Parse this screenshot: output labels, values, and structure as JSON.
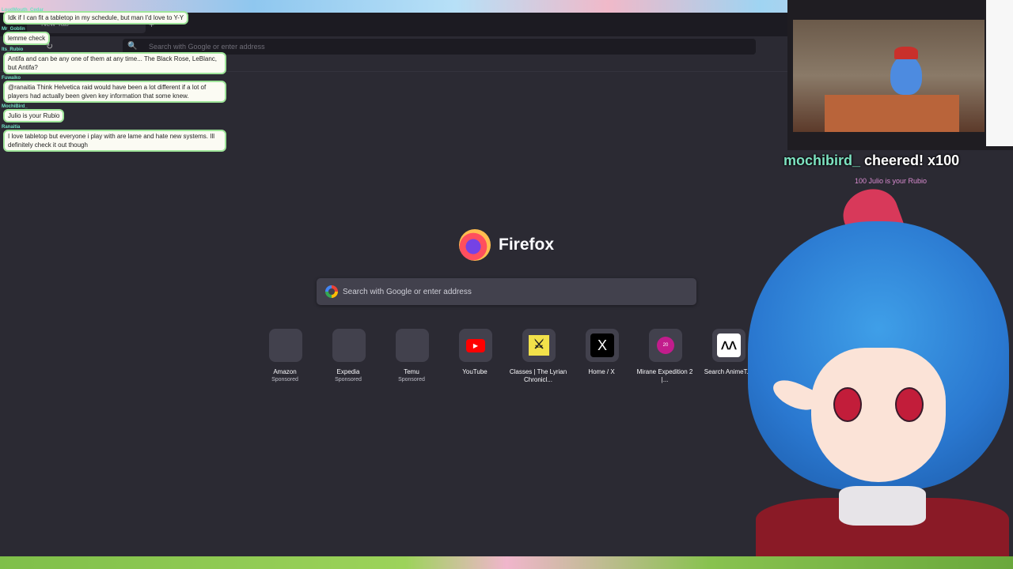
{
  "browser": {
    "tab_title": "New Tab",
    "tab_close": "×",
    "new_tab": "+",
    "reload": "↻",
    "url_placeholder": "Search with Google or enter address",
    "url_search_icon": "🔍"
  },
  "chat": [
    {
      "user": "LoudMouth_Cedar",
      "text": "Idk if I can fit a tabletop in my schedule, but man I'd love to Y-Y"
    },
    {
      "user": "Mr_Goblin",
      "text": "lemme check"
    },
    {
      "user": "Its_Rubio",
      "text": "Antifa and can be any one of them at any time... The Black Rose, LeBlanc, but Antifa?"
    },
    {
      "user": "Fuwaiko",
      "text": "@ranaitia Think Helvetica raid would have been a lot different if a lot of players had actually been given key information that some knew."
    },
    {
      "user": "MochiBird_",
      "text": "Julio is your Rubio"
    },
    {
      "user": "Ranaitia",
      "text": "I love tabletop but everyone i play with are lame and hate new systems. Ill definitely check it out though"
    }
  ],
  "newtab": {
    "brand": "Firefox",
    "search_placeholder": "Search with Google or enter address",
    "shortcuts": [
      {
        "label": "Amazon",
        "sponsor": "Sponsored",
        "icon": "blank-icon"
      },
      {
        "label": "Expedia",
        "sponsor": "Sponsored",
        "icon": "blank-icon"
      },
      {
        "label": "Temu",
        "sponsor": "Sponsored",
        "icon": "blank-icon"
      },
      {
        "label": "YouTube",
        "sponsor": "",
        "icon": "youtube-icon",
        "glyph": "▶"
      },
      {
        "label": "Classes | The Lyrian Chronicl...",
        "sponsor": "",
        "icon": "swords-icon",
        "glyph": "⚔"
      },
      {
        "label": "Home / X",
        "sponsor": "",
        "icon": "x-icon",
        "glyph": "X"
      },
      {
        "label": "Mirane Expedition 2 |...",
        "sponsor": "",
        "icon": "d20-icon",
        "glyph": "20"
      },
      {
        "label": "Search AnimeT...",
        "sponsor": "",
        "icon": "anime-icon",
        "glyph": "ᐱᐱ"
      }
    ]
  },
  "stream": {
    "cheer_user": "mochibird_",
    "cheer_text": " cheered! x100",
    "cheer_message": "100 Julio is your Rubio"
  }
}
